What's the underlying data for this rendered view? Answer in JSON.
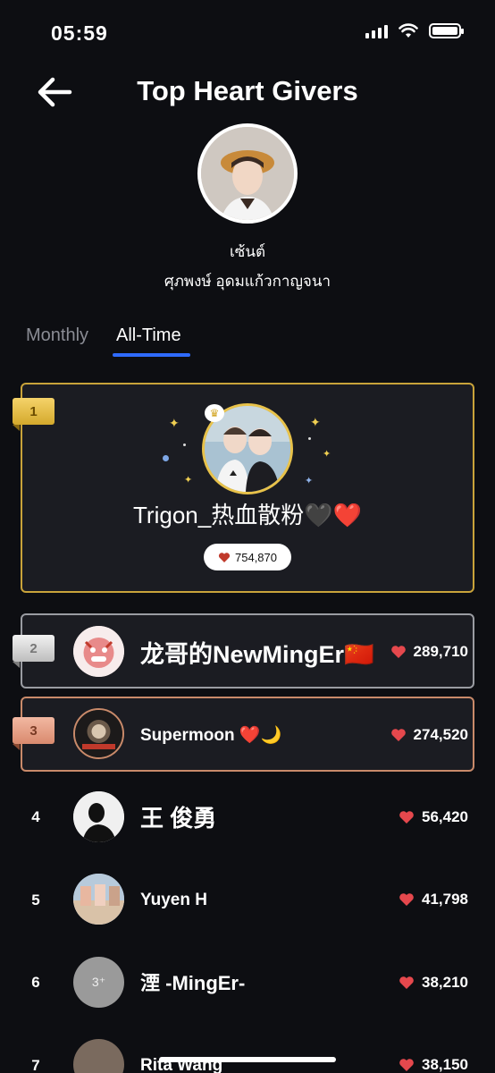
{
  "status": {
    "time": "05:59"
  },
  "header": {
    "title": "Top Heart Givers",
    "back_icon": "arrow-left-icon"
  },
  "profile": {
    "nickname": "เซ้นต์",
    "full_name": "ศุภพงษ์ อุดมแก้วกาญจนา"
  },
  "tabs": {
    "monthly": "Monthly",
    "all_time": "All-Time",
    "active": "All-Time"
  },
  "first": {
    "rank": "1",
    "name": "Trigon_热血散粉🖤❤️",
    "hearts": "754,870"
  },
  "rows": [
    {
      "rank": "2",
      "name": "龙哥的NewMingEr🇨🇳",
      "hearts": "289,710"
    },
    {
      "rank": "3",
      "name": "Supermoon ❤️🌙",
      "hearts": "274,520"
    },
    {
      "rank": "4",
      "name": "王 俊勇",
      "hearts": "56,420"
    },
    {
      "rank": "5",
      "name": "Yuyen H",
      "hearts": "41,798"
    },
    {
      "rank": "6",
      "name": "湮 -MingEr-",
      "hearts": "38,210",
      "avatar_text": "3⁺"
    },
    {
      "rank": "7",
      "name": "Rita Wang",
      "hearts": "38,150"
    }
  ],
  "colors": {
    "accent": "#2f6bff",
    "gold": "#c9a33a",
    "heart": "#e5484d",
    "background": "#0d0e12"
  }
}
